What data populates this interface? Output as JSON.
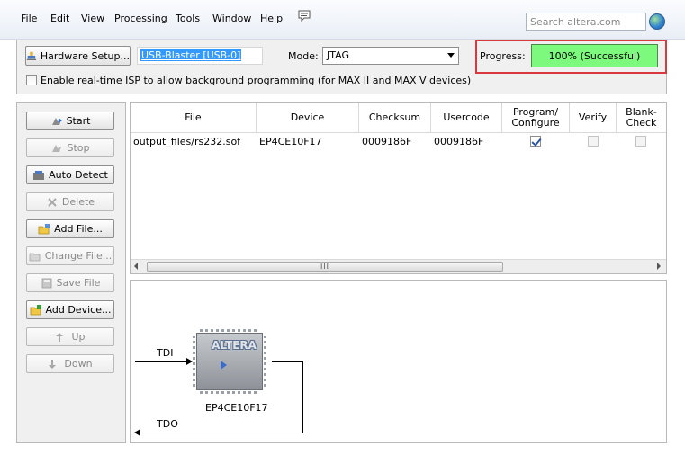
{
  "menu": [
    "File",
    "Edit",
    "View",
    "Processing",
    "Tools",
    "Window",
    "Help"
  ],
  "search": {
    "placeholder": "Search altera.com"
  },
  "toolbar": {
    "hardware_setup_label": "Hardware Setup...",
    "hardware_value": "USB-Blaster [USB-0]",
    "mode_label": "Mode:",
    "mode_value": "JTAG",
    "progress_label": "Progress:",
    "progress_value": "100% (Successful)",
    "progress_fraction": 1.0,
    "isp_label": "Enable real-time ISP to allow background programming (for MAX II and MAX V devices)"
  },
  "side_buttons": [
    {
      "label": "Start",
      "enabled": true
    },
    {
      "label": "Stop",
      "enabled": false
    },
    {
      "label": "Auto Detect",
      "enabled": true
    },
    {
      "label": "Delete",
      "enabled": false
    },
    {
      "label": "Add File...",
      "enabled": true
    },
    {
      "label": "Change File...",
      "enabled": false
    },
    {
      "label": "Save File",
      "enabled": false
    },
    {
      "label": "Add Device...",
      "enabled": true
    },
    {
      "label": "Up",
      "enabled": false
    },
    {
      "label": "Down",
      "enabled": false
    }
  ],
  "table": {
    "headers": [
      "File",
      "Device",
      "Checksum",
      "Usercode",
      "Program/ Configure",
      "Verify",
      "Blank- Check"
    ],
    "rows": [
      {
        "file": "output_files/rs232.sof",
        "device": "EP4CE10F17",
        "checksum": "0009186F",
        "usercode": "0009186F",
        "program": true,
        "verify": false,
        "blank_check": false
      }
    ],
    "scroll_grip": "III"
  },
  "diagram": {
    "tdi_label": "TDI",
    "tdo_label": "TDO",
    "chip_logo": "ALTERA",
    "chip_name": "EP4CE10F17"
  },
  "colors": {
    "progress_fill": "#7dfa7d",
    "highlight_frame": "#d9393e",
    "selection": "#3399ff"
  }
}
